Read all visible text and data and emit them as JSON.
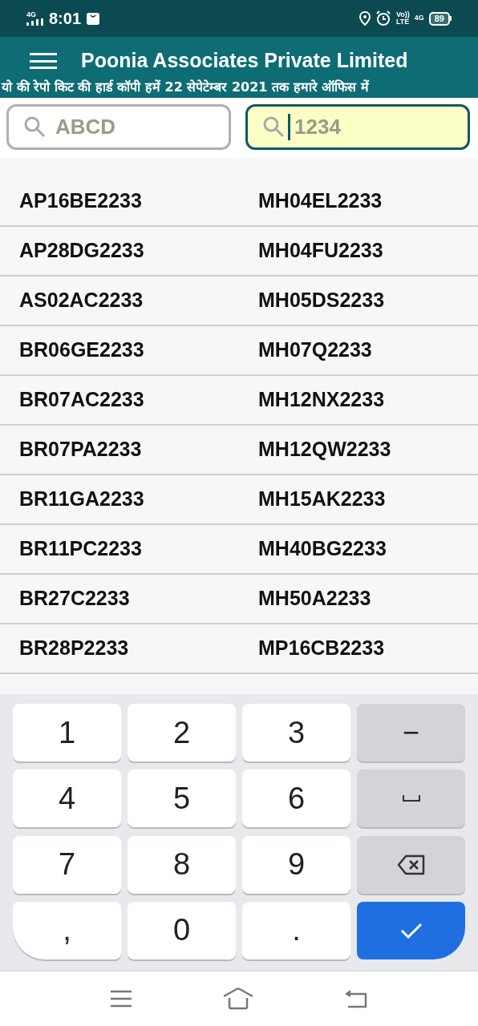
{
  "status_bar": {
    "network": "4G",
    "time": "8:01",
    "volte": "Vo))",
    "lte": "LTE",
    "data": "4G",
    "battery": "89"
  },
  "app_bar": {
    "title": "Poonia Associates Private Limited",
    "ticker": "यो की रेपो किट की हार्ड कॉपी हमें 22 सेपेटेम्बर 2021 तक हमारे ऑफिस में"
  },
  "search_fields": [
    {
      "placeholder": "ABCD",
      "focused": false
    },
    {
      "placeholder": "1234",
      "focused": true
    }
  ],
  "list": {
    "rows": [
      [
        "AP16BE2233",
        "MH04EL2233"
      ],
      [
        "AP28DG2233",
        "MH04FU2233"
      ],
      [
        "AS02AC2233",
        "MH05DS2233"
      ],
      [
        "BR06GE2233",
        "MH07Q2233"
      ],
      [
        "BR07AC2233",
        "MH12NX2233"
      ],
      [
        "BR07PA2233",
        "MH12QW2233"
      ],
      [
        "BR11GA2233",
        "MH15AK2233"
      ],
      [
        "BR11PC2233",
        "MH40BG2233"
      ],
      [
        "BR27C2233",
        "MH50A2233"
      ],
      [
        "BR28P2233",
        "MP16CB2233"
      ]
    ]
  },
  "keyboard": {
    "keys": [
      {
        "kind": "char",
        "label": "1"
      },
      {
        "kind": "char",
        "label": "2"
      },
      {
        "kind": "char",
        "label": "3"
      },
      {
        "kind": "function",
        "label": "−"
      },
      {
        "kind": "char",
        "label": "4"
      },
      {
        "kind": "char",
        "label": "5"
      },
      {
        "kind": "char",
        "label": "6"
      },
      {
        "kind": "space"
      },
      {
        "kind": "char",
        "label": "7"
      },
      {
        "kind": "char",
        "label": "8"
      },
      {
        "kind": "char",
        "label": "9"
      },
      {
        "kind": "backspace"
      },
      {
        "kind": "char",
        "label": ","
      },
      {
        "kind": "char",
        "label": "0"
      },
      {
        "kind": "char",
        "label": "."
      },
      {
        "kind": "done"
      }
    ]
  }
}
